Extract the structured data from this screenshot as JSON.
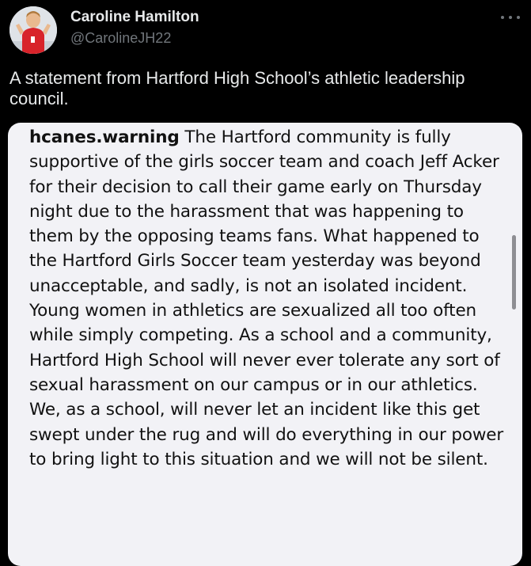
{
  "tweet": {
    "author": {
      "name": "Caroline Hamilton",
      "handle": "@CarolineJH22",
      "avatar_icon": "profile-photo"
    },
    "more_icon": "more-horizontal-icon",
    "text": "A statement from Hartford High School’s athletic leadership council."
  },
  "attached_image": {
    "username": "hcanes.warning",
    "caption": "The Hartford community is fully supportive of the girls soccer team and coach Jeff Acker for their decision to call their game early on Thursday night due to the harassment that was happening to them by the opposing teams fans. What happened to the Hartford Girls Soccer team yesterday was beyond unacceptable, and sadly, is not an isolated incident. Young women in athletics are sexualized all too often while simply competing. As a school and a community, Hartford High School will never ever tolerate any sort of sexual harassment on our campus or in our athletics. We, as a school, will never let an incident like this get swept under the rug and will do everything in our power to bring light to this situation and we will not be silent."
  },
  "colors": {
    "background": "#000000",
    "primary_text": "#e7e9ea",
    "secondary_text": "#71767b",
    "card_background": "#f2f2f6",
    "card_text": "#111111"
  }
}
